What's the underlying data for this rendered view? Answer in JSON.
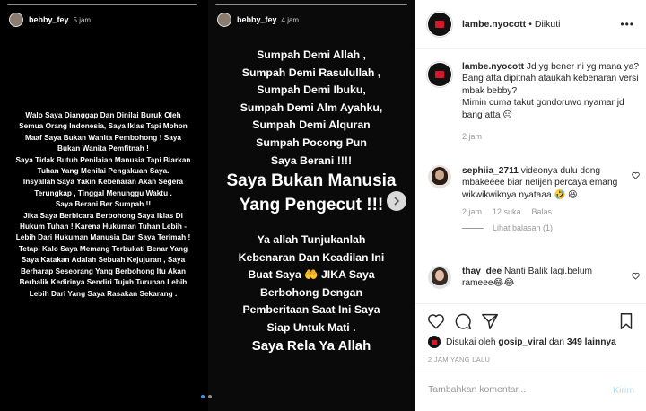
{
  "story1": {
    "username": "bebby_fey",
    "time": "5 jam",
    "text": "Walo Saya Dianggap Dan Dinilai Buruk Oleh\nSemua Orang Indonesia, Saya Iklas Tapi Mohon\nMaaf Saya Bukan Wanita Pembohong !  Saya\nBukan Wanita Pemfitnah !\nSaya Tidak Butuh Penilaian Manusia Tapi Biarkan\nTuhan Yang Menilai Pengakuan Saya.\nInsyallah Saya Yakin Kebenaran Akan Segera\nTerungkap , Tinggal Menunggu Waktu .\nSaya Berani Ber Sumpah !!\nJika Saya Berbicara Berbohong Saya Iklas Di\nHukum Tuhan ! Karena Hukuman Tuhan Lebih -\nLebih Dari Hukuman Manusia Dan Saya Terimah !\nTetapi Kalo Saya Memang Terbukati Benar Yang\nSaya Katakan Adalah Sebuah Kejujuran , Saya\nBerharap Seseorang Yang Berbohong Itu Akan\nBerbalik Kedirinya Sendiri Tujuh Turunan Lebih\nLebih Dari Yang Saya Rasakan Sekarang ."
  },
  "story2": {
    "username": "bebby_fey",
    "time": "4 jam",
    "oaths": "Sumpah Demi Allah ,\nSumpah Demi Rasulullah ,\nSumpah Demi Ibuku,\nSumpah Demi Alm Ayahku,\nSumpah Demi Alquran\nSumpah Pocong Pun\nSaya Berani !!!!",
    "headline": "Saya Bukan Manusia\nYang Pengecut !!!",
    "plea": "Ya allah Tunjukanlah\nKebenaran Dan Keadilan Ini\nBuat Saya 🤲 JIKA Saya\nBerbohong Dengan\nPemberitaan Saat Ini Saya\nSiap Untuk Mati .",
    "closing": "Saya Rela Ya Allah"
  },
  "header": {
    "username": "lambe.nyocott",
    "separator": "•",
    "follow_status": "Diikuti",
    "more_icon": "more-horizontal-icon"
  },
  "caption": {
    "username": "lambe.nyocott",
    "lines": [
      "Jd yg bener ni yg mana ya?",
      "Bang atta dipitnah ataukah kebenaran versi mbak bebby?",
      "Mimin cuma takut gondoruwo nyamar jd bang atta 😑"
    ],
    "time": "2 jam"
  },
  "comments": [
    {
      "username": "sephiia_2711",
      "text": "videonya dulu dong mbakeeee biar netijen percaya emang wikwikwiknya nyataaa 🤣 😆",
      "time": "2 jam",
      "likes": "12 suka",
      "reply": "Balas",
      "view_replies": "Lihat balasan (1)"
    },
    {
      "username": "thay_dee",
      "text": "Nanti Balik lagi.belum rameee😂😂"
    }
  ],
  "likes": {
    "prefix": "Disukai oleh",
    "user": "gosip_viral",
    "connector": "dan",
    "count": "349 lainnya"
  },
  "posted_ago": "2 JAM YANG LALU",
  "add_comment": {
    "placeholder": "Tambahkan komentar...",
    "post_label": "Kirim"
  },
  "colors": {
    "accent_blue": "#3897f0",
    "disabled_blue": "#b2dffc",
    "muted_text": "#999999",
    "brand_red": "#d8162a"
  }
}
